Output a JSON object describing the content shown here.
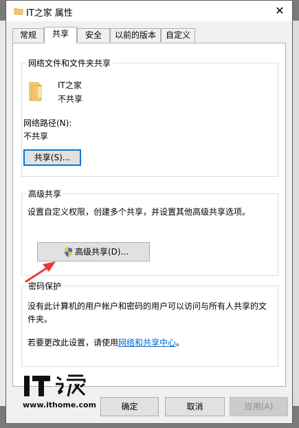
{
  "window": {
    "title": "IT之家 属性",
    "close_label": "✕"
  },
  "tabs": [
    {
      "label": "常规"
    },
    {
      "label": "共享"
    },
    {
      "label": "安全"
    },
    {
      "label": "以前的版本"
    },
    {
      "label": "自定义"
    }
  ],
  "network_share": {
    "group_title": "网络文件和文件夹共享",
    "folder_name": "IT之家",
    "folder_status": "不共享",
    "path_label": "网络路径(N):",
    "path_value": "不共享",
    "share_button": "共享(S)..."
  },
  "advanced_share": {
    "group_title": "高级共享",
    "description": "设置自定义权限，创建多个共享，并设置其他高级共享选项。",
    "button": "高级共享(D)..."
  },
  "password_protection": {
    "group_title": "密码保护",
    "description_line1": "没有此计算机的用户帐户和密码的用户可以访问与所有人共享的文",
    "description_line2": "件夹。",
    "change_prefix": "若要更改此设置，请使用",
    "change_link": "网络和共享中心",
    "change_suffix": "。"
  },
  "footer": {
    "ok": "确定",
    "cancel": "取消",
    "apply": "应用(A)"
  },
  "watermark": {
    "url": "www.ithome.com"
  },
  "colors": {
    "accent": "#0078d7",
    "link": "#0066cc",
    "arrow": "#e8383d",
    "folder": "#f2c76a"
  }
}
